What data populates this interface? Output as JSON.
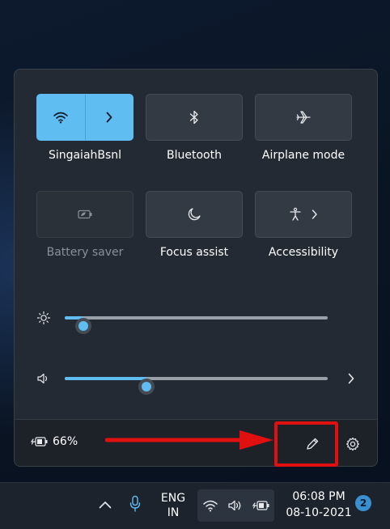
{
  "quick_settings": {
    "tiles": [
      {
        "label": "SingaiahBsnl",
        "icon": "wifi-icon",
        "state": "on",
        "has_chevron": true
      },
      {
        "label": "Bluetooth",
        "icon": "bluetooth-icon",
        "state": "off"
      },
      {
        "label": "Airplane mode",
        "icon": "airplane-icon",
        "state": "off"
      },
      {
        "label": "Battery saver",
        "icon": "battery-saver-icon",
        "state": "disabled"
      },
      {
        "label": "Focus assist",
        "icon": "moon-icon",
        "state": "off"
      },
      {
        "label": "Accessibility",
        "icon": "accessibility-icon",
        "state": "off",
        "has_chevron": true
      }
    ],
    "brightness": {
      "icon": "brightness-icon",
      "level_percent": 7
    },
    "volume": {
      "icon": "speaker-icon",
      "level_percent": 31
    },
    "footer": {
      "battery_percent": "66%",
      "battery_icon": "battery-charging-icon",
      "edit_icon": "pencil-icon",
      "settings_icon": "gear-icon"
    }
  },
  "annotation": {
    "color": "#e01010",
    "target": "edit-quick-settings-button"
  },
  "taskbar": {
    "language_line1": "ENG",
    "language_line2": "IN",
    "time": "06:08 PM",
    "date": "08-10-2021",
    "notification_count": "2"
  },
  "colors": {
    "accent": "#60bdf2",
    "panel": "#242a33",
    "tile": "#343a43"
  }
}
